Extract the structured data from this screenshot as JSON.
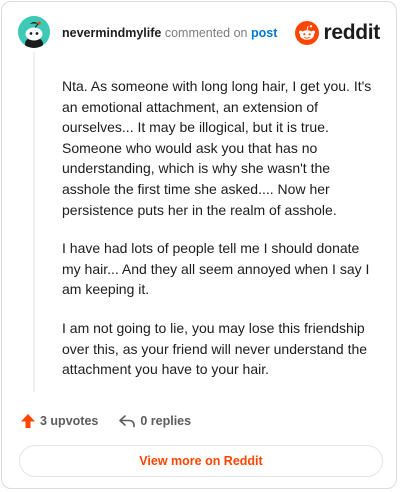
{
  "header": {
    "username": "nevermindmylife",
    "action_text": "commented on",
    "post_link": "post",
    "brand": "reddit"
  },
  "comment": {
    "paragraphs": [
      "Nta. As someone with long long hair, I get you. It's an emotional attachment, an extension of ourselves... It may be illogical, but it is true. Someone who would ask you that has no understanding, which is why she wasn't the asshole the first time she asked.... Now her persistence puts her in the realm of asshole.",
      "I have had lots of people tell me I should donate my hair... And they all seem annoyed when I say I am keeping it.",
      "I am not going to lie, you may lose this friendship over this, as your friend will never understand the attachment you have to your hair."
    ]
  },
  "actions": {
    "upvotes": "3 upvotes",
    "replies": "0 replies"
  },
  "footer": {
    "view_more": "View more on Reddit"
  },
  "colors": {
    "accent": "#ff4500",
    "link": "#0079d3",
    "avatar_bg": "#3ec9b6"
  },
  "icons": [
    "avatar-snoo",
    "reddit-logo-icon",
    "upvote-arrow-icon",
    "reply-arrow-icon"
  ]
}
